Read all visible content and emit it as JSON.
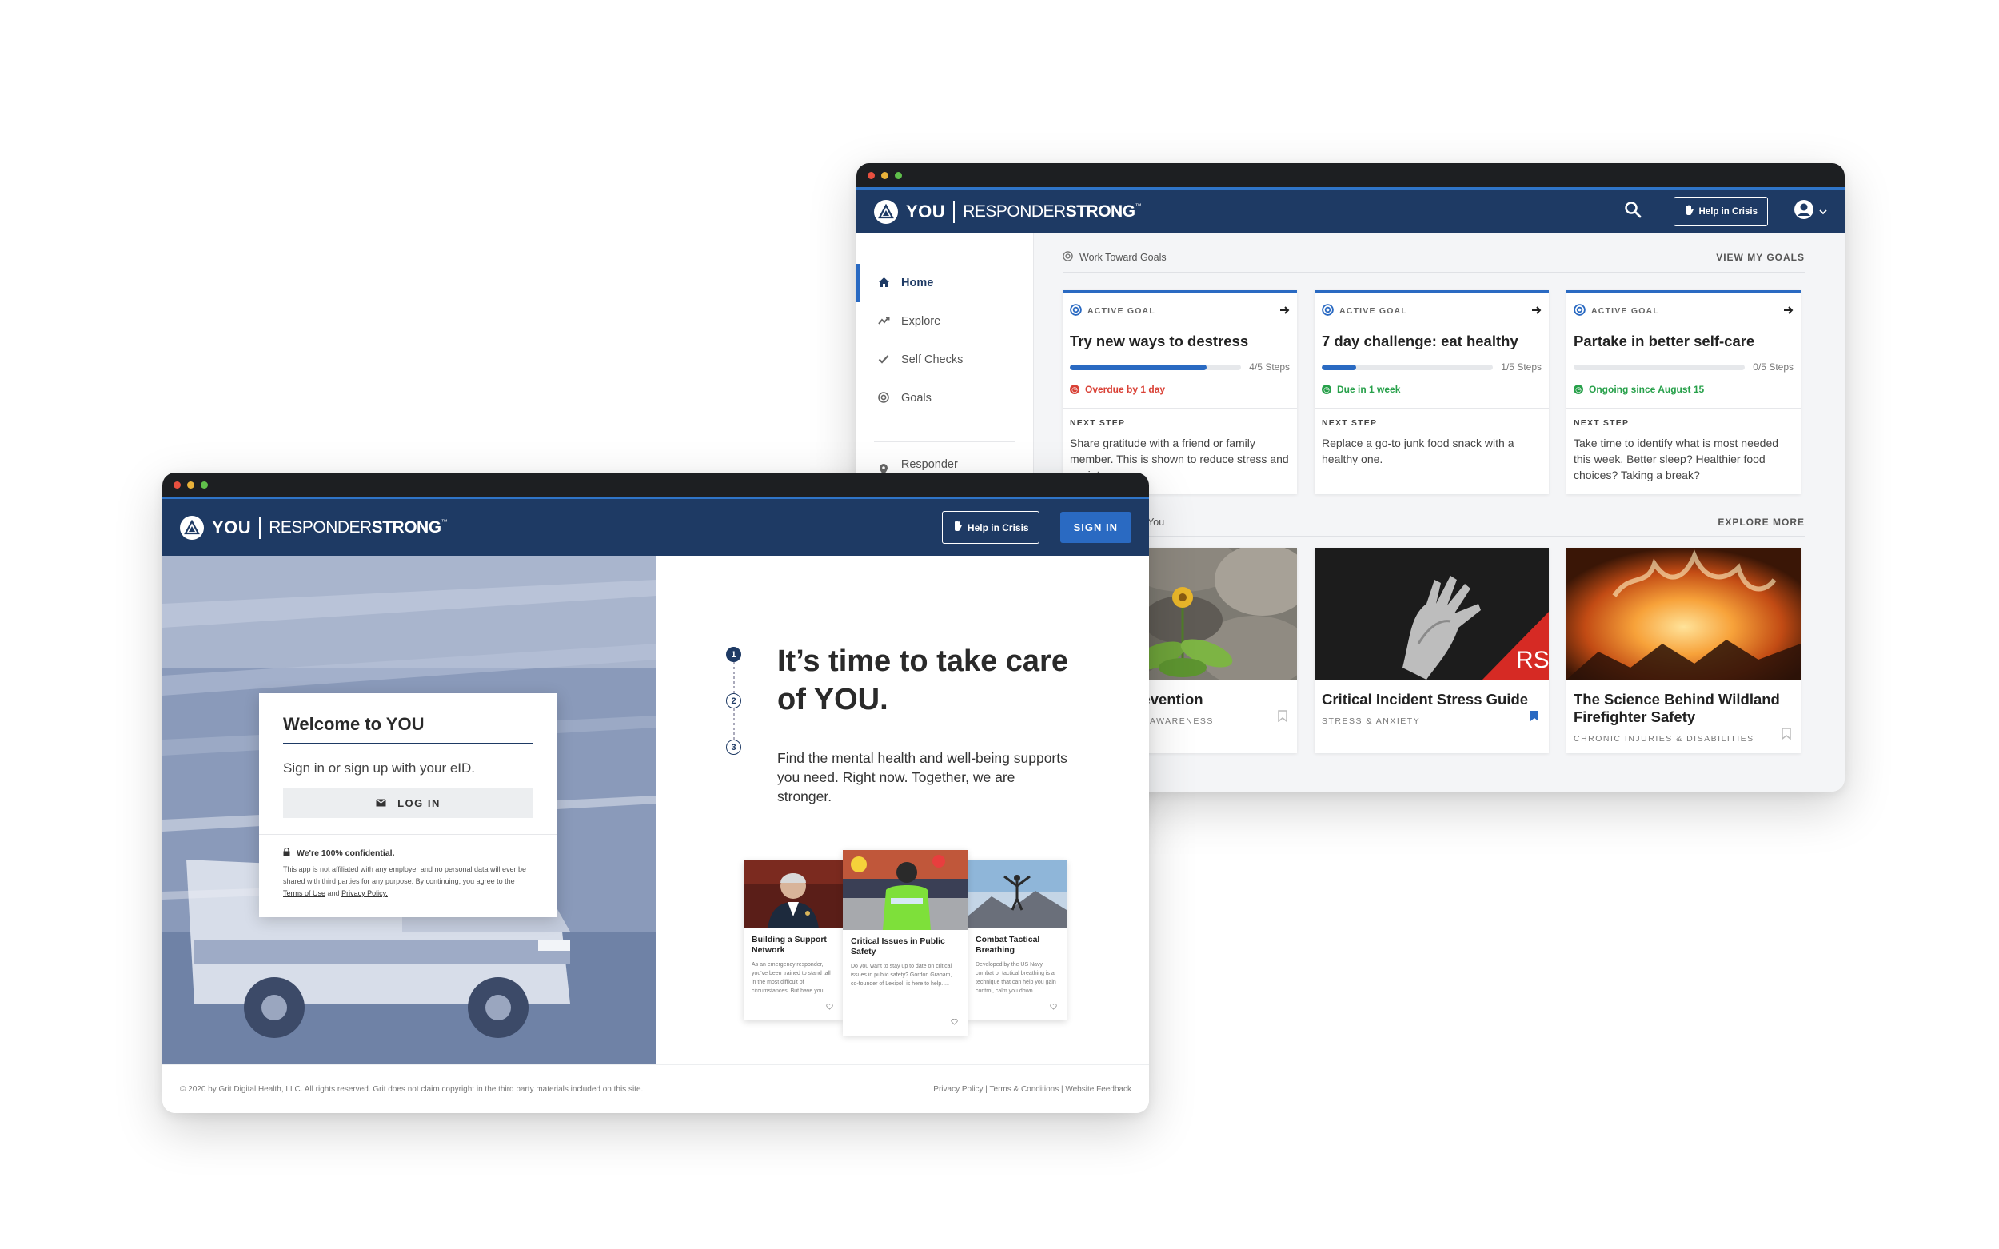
{
  "brand": {
    "you": "YOU",
    "rs_light": "RESPONDER",
    "rs_bold": "STRONG",
    "tm": "™"
  },
  "dashboard": {
    "help_in_crisis": "Help in Crisis",
    "nav": [
      {
        "label": "Home",
        "icon": "home-icon",
        "active": true
      },
      {
        "label": "Explore",
        "icon": "trend-icon",
        "active": false
      },
      {
        "label": "Self Checks",
        "icon": "check-icon",
        "active": false
      },
      {
        "label": "Goals",
        "icon": "target-icon",
        "active": false
      },
      {
        "label": "Responder Resources",
        "icon": "pin-icon",
        "active": false
      }
    ],
    "goals_section": {
      "title": "Work Toward Goals",
      "link": "VIEW MY GOALS"
    },
    "goals": [
      {
        "tag": "ACTIVE GOAL",
        "title": "Try new ways to destress",
        "progress": 0.8,
        "steps": "4/5 Steps",
        "status": "Overdue by 1 day",
        "status_color": "#d94136",
        "next_label": "NEXT STEP",
        "next": "Share gratitude with a friend or family member. This is shown to reduce stress and anxiety."
      },
      {
        "tag": "ACTIVE GOAL",
        "title": "7 day challenge: eat healthy",
        "progress": 0.2,
        "steps": "1/5 Steps",
        "status": "Due in 1 week",
        "status_color": "#27a04a",
        "next_label": "NEXT STEP",
        "next": "Replace a go-to junk food snack with a healthy one."
      },
      {
        "tag": "ACTIVE GOAL",
        "title": "Partake in better self-care",
        "progress": 0.0,
        "steps": "0/5 Steps",
        "status": "Ongoing since August 15",
        "status_color": "#27a04a",
        "next_label": "NEXT STEP",
        "next": "Take time to identify what is most needed this week. Better sleep? Healthier food choices? Taking a break?"
      }
    ],
    "rec_section": {
      "title": "Recommended for You",
      "link": "EXPLORE MORE"
    },
    "recs": [
      {
        "title": "Suicide Prevention",
        "tag": "PREVENTION & AWARENESS",
        "saved": false
      },
      {
        "title": "Critical Incident Stress Guide",
        "tag": "STRESS & ANXIETY",
        "saved": true,
        "badge": "RS"
      },
      {
        "title": "The Science Behind Wildland Firefighter Safety",
        "tag": "CHRONIC INJURIES & DISABILITIES",
        "saved": false
      }
    ]
  },
  "login": {
    "help_in_crisis": "Help in Crisis",
    "sign_in": "SIGN IN",
    "card_title": "Welcome to YOU",
    "card_sub": "Sign in or sign up with your eID.",
    "login_btn": "LOG IN",
    "conf_title": "We're 100% confidential.",
    "conf_txt": "This app is not affiliated with any employer and no personal data will ever be shared with third parties for any purpose. By continuing, you agree to the",
    "terms": "Terms of Use",
    "and": "and",
    "privacy": "Privacy Policy.",
    "steps": [
      "1",
      "2",
      "3"
    ],
    "headline": "It’s time to take care of YOU.",
    "intro": "Find the mental health and well-being supports you need. Right now. Together, we are stronger.",
    "minis": [
      {
        "title": "Building a Support Network",
        "txt": "As an emergency responder, you've been trained to stand tall in the most difficult of circumstances. But have you ..."
      },
      {
        "title": "Critical Issues in Public Safety",
        "txt": "Do you want to stay up to date on critical issues in public safety? Gordon Graham, co-founder of Lexipol, is here to help. ..."
      },
      {
        "title": "Combat Tactical Breathing",
        "txt": "Developed by the US Navy, combat or tactical breathing is a technique that can help you gain control, calm you down ..."
      }
    ],
    "footer_left": "© 2020 by Grit Digital Health, LLC. All rights reserved. Grit does not claim copyright in the third party materials included on this site.",
    "footer_right": "Privacy Policy | Terms & Conditions | Website Feedback"
  }
}
